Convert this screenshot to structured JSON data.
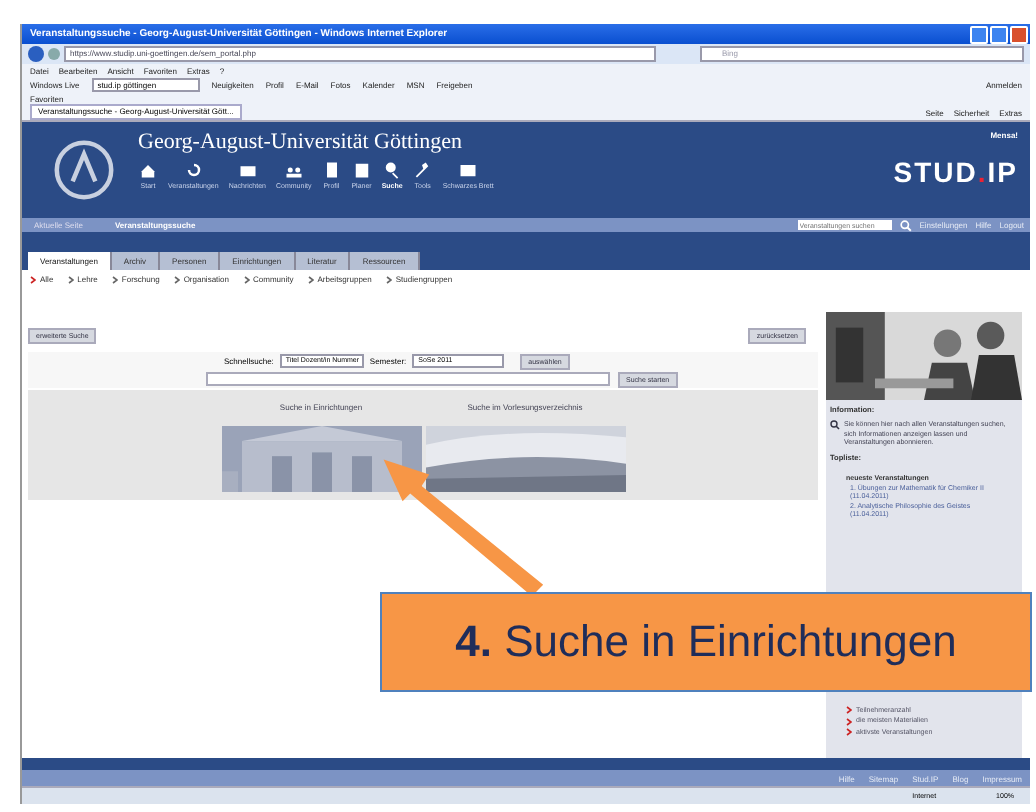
{
  "browser": {
    "title": "Veranstaltungssuche - Georg-August-Universität Göttingen - Windows Internet Explorer",
    "address": "https://www.studip.uni-goettingen.de/sem_portal.php",
    "search_placeholder": "Bing",
    "menu": [
      "Datei",
      "Bearbeiten",
      "Ansicht",
      "Favoriten",
      "Extras",
      "?"
    ],
    "toolbar": {
      "brand": "Windows Live",
      "search_value": "stud.ip göttingen",
      "links": [
        "Neuigkeiten",
        "Profil",
        "E-Mail",
        "Fotos",
        "Kalender",
        "MSN",
        "Freigeben"
      ],
      "signin": "Anmelden"
    },
    "favorites": "Favoriten",
    "tab": "Veranstaltungssuche - Georg-August-Universität Gött...",
    "commands": [
      "Seite",
      "Sicherheit",
      "Extras"
    ]
  },
  "site": {
    "university": "Georg-August-Universität Göttingen",
    "notice": "Mensa!",
    "logo_main": "STUD",
    "logo_dot": ".",
    "logo_end": "IP",
    "nav": [
      {
        "label": "Start",
        "selected": false
      },
      {
        "label": "Veranstaltungen",
        "selected": false
      },
      {
        "label": "Nachrichten",
        "selected": false
      },
      {
        "label": "Community",
        "selected": false
      },
      {
        "label": "Profil",
        "selected": false
      },
      {
        "label": "Planer",
        "selected": false
      },
      {
        "label": "Suche",
        "selected": true
      },
      {
        "label": "Tools",
        "selected": false
      },
      {
        "label": "Schwarzes Brett",
        "selected": false
      }
    ],
    "breadcrumb": {
      "label": "Aktuelle Seite",
      "page": "Veranstaltungssuche"
    },
    "quick_search_placeholder": "Veranstaltungen suchen",
    "user_links": [
      "Einstellungen",
      "Hilfe",
      "Logout"
    ]
  },
  "tabs": [
    {
      "label": "Veranstaltungen",
      "selected": true
    },
    {
      "label": "Archiv",
      "selected": false
    },
    {
      "label": "Personen",
      "selected": false
    },
    {
      "label": "Einrichtungen",
      "selected": false
    },
    {
      "label": "Literatur",
      "selected": false
    },
    {
      "label": "Ressourcen",
      "selected": false
    }
  ],
  "subnav": [
    {
      "label": "Alle",
      "selected": true
    },
    {
      "label": "Lehre",
      "selected": false
    },
    {
      "label": "Forschung",
      "selected": false
    },
    {
      "label": "Organisation",
      "selected": false
    },
    {
      "label": "Community",
      "selected": false
    },
    {
      "label": "Arbeitsgruppen",
      "selected": false
    },
    {
      "label": "Studiengruppen",
      "selected": false
    }
  ],
  "search": {
    "advanced": "erweiterte Suche",
    "reset": "zurücksetzen",
    "quick_label": "Schnellsuche:",
    "quick_select": "Titel Dozent/in Nummer",
    "semester_label": "Semester:",
    "semester_select": "SoSe 2011",
    "choose": "auswählen",
    "submit": "Suche starten",
    "panels": [
      {
        "title": "Suche in Einrichtungen",
        "kind": "picture"
      },
      {
        "title": "Suche im Vorlesungsverzeichnis",
        "kind": "picture"
      }
    ]
  },
  "sidebar": {
    "info_title": "Information:",
    "info_text": "Sie können hier nach allen Veranstaltungen suchen, sich Informationen anzeigen lassen und Veranstaltungen abonnieren.",
    "top_title": "Topliste:",
    "newest_title": "neueste Veranstaltungen",
    "newest": [
      "1. Übungen zur Mathematik für Chemiker II (11.04.2011)",
      "2. Analytische Philosophie des Geistes (11.04.2011)"
    ],
    "links": [
      "Teilnehmeranzahl",
      "die meisten Materialien",
      "aktivste Veranstaltungen"
    ]
  },
  "footer": [
    "Hilfe",
    "Sitemap",
    "Stud.IP",
    "Blog",
    "Impressum"
  ],
  "status": {
    "zone": "Internet",
    "zoom": "100%"
  },
  "callout": "**4.** Suche in Einrichtungen"
}
